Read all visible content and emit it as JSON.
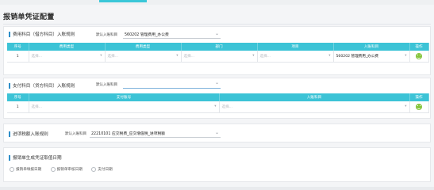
{
  "page": {
    "title": "报销单凭证配置"
  },
  "section1": {
    "title": "费用科目（借方科目）入账规则",
    "default_label": "默认入账科目",
    "default_value": "560202 管理费用_办公费",
    "columns": [
      "序号",
      "费用类型",
      "费用类型",
      "部门",
      "项目",
      "入账科目",
      "操作"
    ],
    "rows": [
      {
        "index": "1",
        "cells": [
          "选择...",
          "选择...",
          "选择...",
          "选择..."
        ],
        "account": "560202 管理费用_办公费"
      }
    ]
  },
  "section2": {
    "title": "支付科目（贷方科目）入账规则",
    "default_label": "默认入账科目",
    "default_value": "",
    "columns": [
      "序号",
      "支付账号",
      "入账科目",
      "操作"
    ],
    "rows": [
      {
        "index": "1",
        "cells": [
          "选择...",
          "选择..."
        ]
      }
    ]
  },
  "section3": {
    "title": "进项税额入账规则",
    "default_label": "默认入账科目",
    "default_value": "22210101 应交税费_应交增值税_进项税额"
  },
  "section4": {
    "title": "报销单生成凭证取值日期",
    "options": [
      "报销单填报日期",
      "报销单审核日期",
      "支付日期"
    ]
  }
}
